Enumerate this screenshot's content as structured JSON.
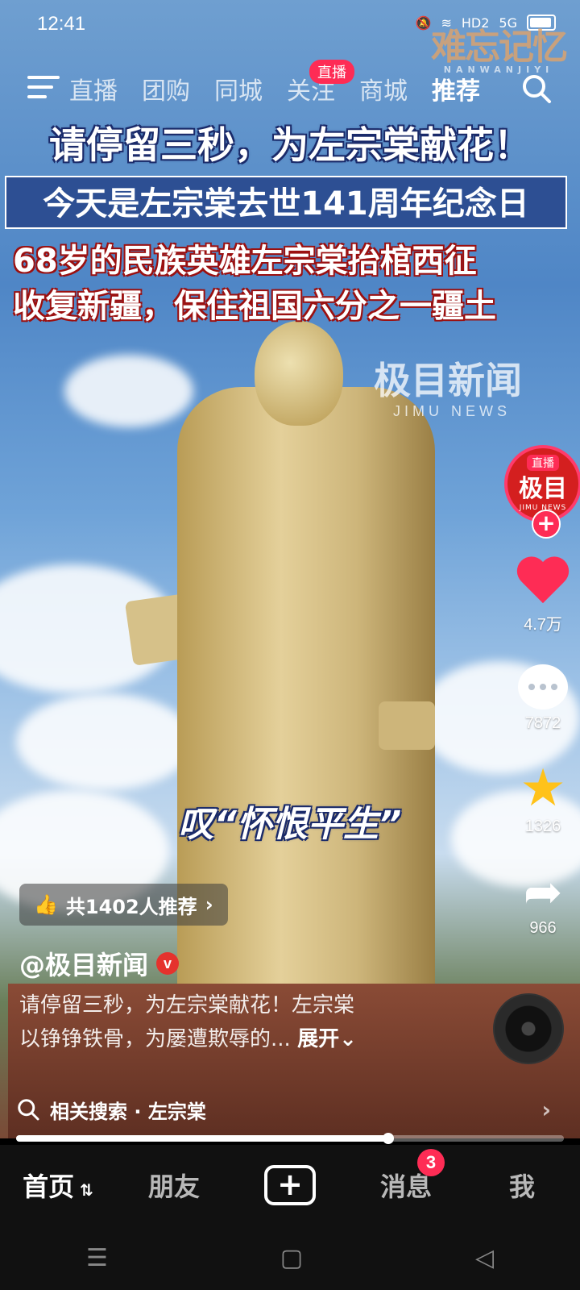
{
  "status_bar": {
    "time": "12:41",
    "network": "5G",
    "hd": "HD2"
  },
  "watermark_top": {
    "text": "难忘记忆",
    "sub": "NANWANJIYI"
  },
  "top_nav": {
    "tabs": [
      "直播",
      "团购",
      "同城",
      "关注",
      "商城",
      "推荐"
    ],
    "active_tab": "推荐",
    "live_badge": "直播"
  },
  "video": {
    "headline1": "请停留三秒，为左宗棠献花！",
    "headline2": "今天是左宗棠去世141周年纪念日",
    "headline3_line1": "68岁的民族英雄左宗棠抬棺西征",
    "headline3_line2": "收复新疆，保住祖国六分之一疆土",
    "watermark_name": "极目新闻",
    "watermark_sub": "JIMU NEWS",
    "caption": "叹“怀恨平生”"
  },
  "rail": {
    "avatar_live": "直播",
    "avatar_name": "极目",
    "avatar_sub": "JIMU NEWS",
    "likes": "4.7万",
    "comments": "7872",
    "favorites": "1326",
    "shares": "966"
  },
  "info": {
    "recommend": "共1402人推荐",
    "author": "@极目新闻",
    "verified": "v",
    "desc_line1": "请停留三秒，为左宗棠献花！左宗棠",
    "desc_line2": "以铮铮铁骨，为屡遭欺辱的...",
    "expand": "展开",
    "related_search": "相关搜索 · 左宗棠",
    "progress": 0.68
  },
  "tabbar": {
    "home": "首页",
    "friends": "朋友",
    "messages": "消息",
    "messages_badge": "3",
    "me": "我"
  }
}
